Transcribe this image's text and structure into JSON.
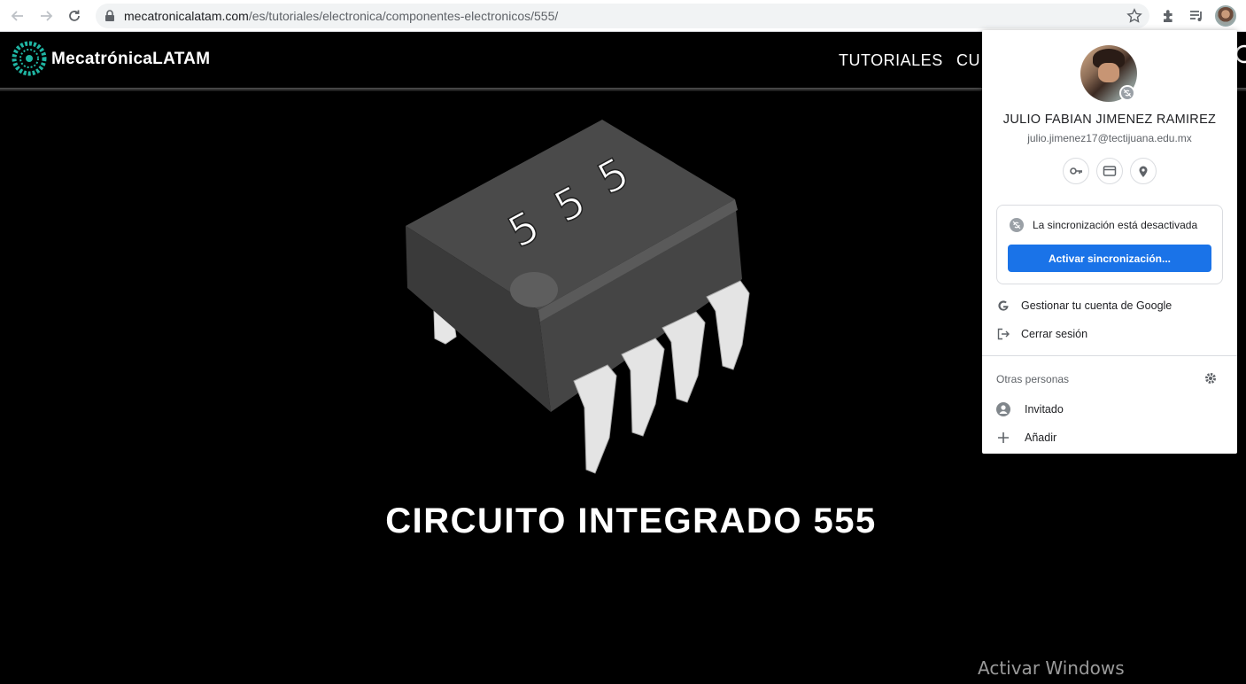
{
  "browser": {
    "url_host": "mecatronicalatam.com",
    "url_path": "/es/tutoriales/electronica/componentes-electronicos/555/"
  },
  "site": {
    "logo_text": "MecatrónicaLATAM",
    "nav": [
      "TUTORIALES",
      "CU"
    ]
  },
  "hero": {
    "chip_label": [
      "5",
      "5",
      "5"
    ],
    "title": "CIRCUITO INTEGRADO 555"
  },
  "profile": {
    "name": "JULIO FABIAN JIMENEZ RAMIREZ",
    "email": "julio.jimenez17@tectijuana.edu.mx",
    "sync_status": "La sincronización está desactivada",
    "sync_button": "Activar sincronización...",
    "manage_account": "Gestionar tu cuenta de Google",
    "sign_out": "Cerrar sesión",
    "others_label": "Otras personas",
    "guest": "Invitado",
    "add": "Añadir"
  },
  "watermark": {
    "line1": "Activar Windows"
  },
  "colors": {
    "accent": "#1a73e8",
    "logo_teal": "#1fb5a3",
    "chip_body": "#474747"
  }
}
